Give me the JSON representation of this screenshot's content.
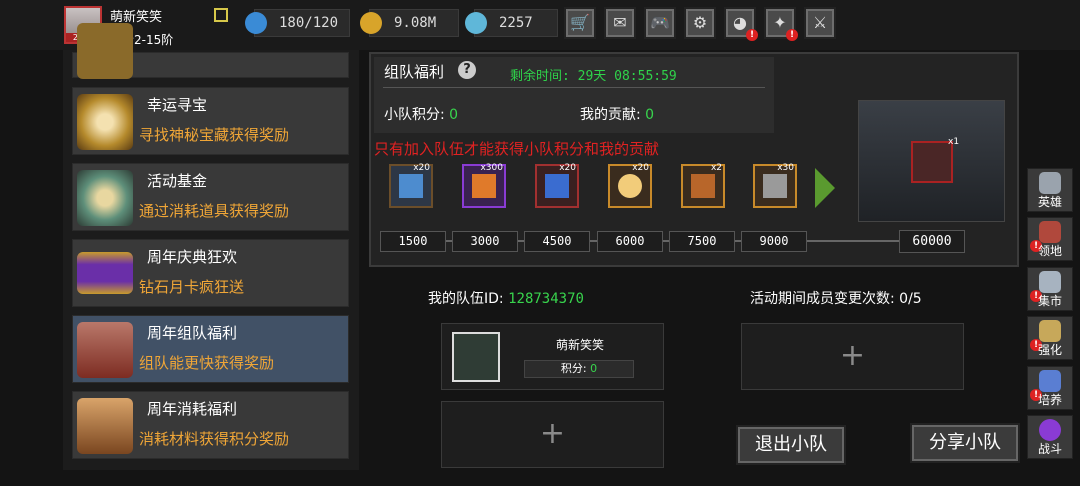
{
  "player": {
    "name": "萌新笑笑",
    "level": "勇者2-15阶",
    "avatar_year": "2026"
  },
  "resources": {
    "stamina": "180/120",
    "gold": "9.08M",
    "gems": "2257"
  },
  "toolbar_icons": [
    "shop-cart-icon",
    "mail-icon",
    "gamepad-icon",
    "settings-gear-icon",
    "color-wheel-icon",
    "fireworks-icon",
    "crossed-swords-icon"
  ],
  "left_list": [
    {
      "title": "",
      "desc": "",
      "partial": true
    },
    {
      "title": "幸运寻宝",
      "desc": "寻找神秘宝藏获得奖励"
    },
    {
      "title": "活动基金",
      "desc": "通过消耗道具获得奖励"
    },
    {
      "title": "周年庆典狂欢",
      "desc": "钻石月卡疯狂送"
    },
    {
      "title": "周年组队福利",
      "desc": "组队能更快获得奖励"
    },
    {
      "title": "周年消耗福利",
      "desc": "消耗材料获得积分奖励"
    }
  ],
  "event": {
    "title": "组队福利",
    "remaining": "剩余时间: 29天 08:55:59",
    "squad_points_label": "小队积分:",
    "squad_points": "0",
    "contribution_label": "我的贡献:",
    "contribution": "0",
    "warning": "只有加入队伍才能获得小队积分和我的贡献"
  },
  "rewards": [
    {
      "qty": "x20",
      "icon": "lightning-scroll-icon",
      "color": "#4d8ccf"
    },
    {
      "qty": "x300",
      "icon": "flame-essence-icon",
      "color": "#e07a2a"
    },
    {
      "qty": "x20",
      "icon": "blue-crystal-icon",
      "color": "#3a6cd0"
    },
    {
      "qty": "x20",
      "icon": "golden-egg-icon",
      "color": "#f2cc7a"
    },
    {
      "qty": "x2",
      "icon": "torch-icon",
      "color": "#b8662a"
    },
    {
      "qty": "x30",
      "icon": "war-hammer-icon",
      "color": "#9a9a9a"
    }
  ],
  "milestones": [
    "1500",
    "3000",
    "4500",
    "6000",
    "7500",
    "9000"
  ],
  "final_goal": "60000",
  "final_reward_qty": "x1",
  "team": {
    "id_label": "我的队伍ID:",
    "id": "128734370",
    "changes": "活动期间成员变更次数: 0/5",
    "member_name": "萌新笑笑",
    "member_score_label": "积分:",
    "member_score": "0",
    "empty_slot": "+"
  },
  "buttons": {
    "leave": "退出小队",
    "share": "分享小队"
  },
  "side_nav": [
    {
      "label": "英雄",
      "icon": "helmet-icon",
      "color": "#9aa3ad",
      "alert": false
    },
    {
      "label": "领地",
      "icon": "castle-icon",
      "color": "#b0483c",
      "alert": true
    },
    {
      "label": "集市",
      "icon": "market-icon",
      "color": "#a7b3c0",
      "alert": true
    },
    {
      "label": "强化",
      "icon": "enhance-crystal-icon",
      "color": "#c7a85a",
      "alert": true
    },
    {
      "label": "培养",
      "icon": "potion-icon",
      "color": "#5a7ed2",
      "alert": true
    },
    {
      "label": "战斗",
      "icon": "portal-icon",
      "color": "#8a3bd4",
      "alert": false
    }
  ]
}
